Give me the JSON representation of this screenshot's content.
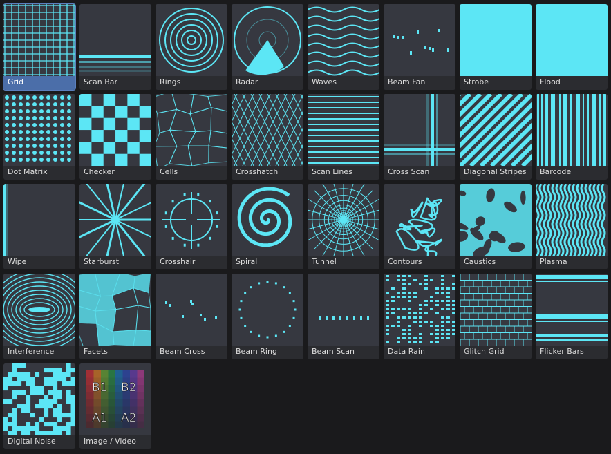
{
  "accent": "#5ce6f5",
  "tile_bg": "#363840",
  "selected_color": "#4b6ea9",
  "selected_index": 0,
  "patterns": [
    {
      "label": "Grid",
      "icon": "grid-icon"
    },
    {
      "label": "Scan Bar",
      "icon": "scan-bar-icon"
    },
    {
      "label": "Rings",
      "icon": "rings-icon"
    },
    {
      "label": "Radar",
      "icon": "radar-icon"
    },
    {
      "label": "Waves",
      "icon": "waves-icon"
    },
    {
      "label": "Beam Fan",
      "icon": "beam-fan-icon"
    },
    {
      "label": "Strobe",
      "icon": "strobe-icon"
    },
    {
      "label": "Flood",
      "icon": "flood-icon"
    },
    {
      "label": "Dot Matrix",
      "icon": "dot-matrix-icon"
    },
    {
      "label": "Checker",
      "icon": "checker-icon"
    },
    {
      "label": "Cells",
      "icon": "cells-icon"
    },
    {
      "label": "Crosshatch",
      "icon": "crosshatch-icon"
    },
    {
      "label": "Scan Lines",
      "icon": "scan-lines-icon"
    },
    {
      "label": "Cross Scan",
      "icon": "cross-scan-icon"
    },
    {
      "label": "Diagonal Stripes",
      "icon": "diagonal-stripes-icon"
    },
    {
      "label": "Barcode",
      "icon": "barcode-icon"
    },
    {
      "label": "Wipe",
      "icon": "wipe-icon"
    },
    {
      "label": "Starburst",
      "icon": "starburst-icon"
    },
    {
      "label": "Crosshair",
      "icon": "crosshair-icon"
    },
    {
      "label": "Spiral",
      "icon": "spiral-icon"
    },
    {
      "label": "Tunnel",
      "icon": "tunnel-icon"
    },
    {
      "label": "Contours",
      "icon": "contours-icon"
    },
    {
      "label": "Caustics",
      "icon": "caustics-icon"
    },
    {
      "label": "Plasma",
      "icon": "plasma-icon"
    },
    {
      "label": "Interference",
      "icon": "interference-icon"
    },
    {
      "label": "Facets",
      "icon": "facets-icon"
    },
    {
      "label": "Beam Cross",
      "icon": "beam-cross-icon"
    },
    {
      "label": "Beam Ring",
      "icon": "beam-ring-icon"
    },
    {
      "label": "Beam Scan",
      "icon": "beam-scan-icon"
    },
    {
      "label": "Data Rain",
      "icon": "data-rain-icon"
    },
    {
      "label": "Glitch Grid",
      "icon": "glitch-grid-icon"
    },
    {
      "label": "Flicker Bars",
      "icon": "flicker-bars-icon"
    },
    {
      "label": "Digital Noise",
      "icon": "digital-noise-icon"
    },
    {
      "label": "Image / Video",
      "icon": "image-video-icon",
      "thumb_labels": [
        "B1",
        "B2",
        "A1",
        "A2"
      ]
    }
  ]
}
